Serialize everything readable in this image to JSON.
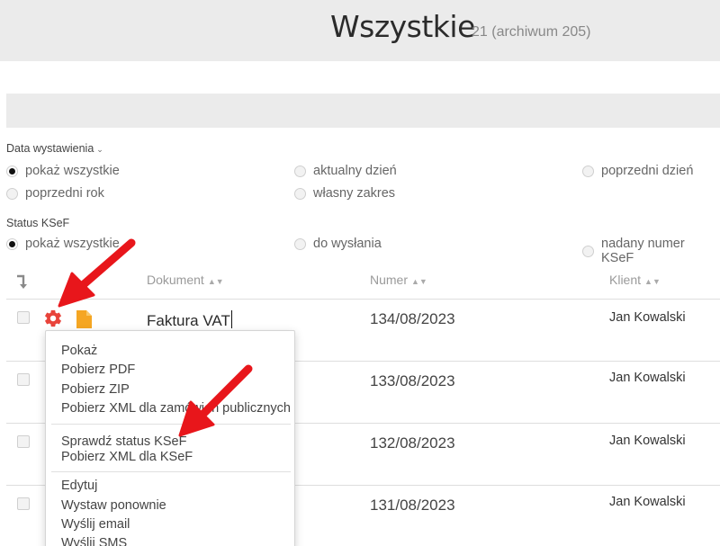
{
  "header": {
    "title": "Wszystkie",
    "count": "21 (archiwum 205)"
  },
  "filters": {
    "date": {
      "label": "Data wystawienia",
      "options": [
        {
          "label": "pokaż wszystkie",
          "checked": true
        },
        {
          "label": "aktualny dzień",
          "checked": false
        },
        {
          "label": "poprzedni dzień",
          "checked": false
        },
        {
          "label": "poprzedni rok",
          "checked": false
        },
        {
          "label": "własny zakres",
          "checked": false
        }
      ]
    },
    "ksef": {
      "label": "Status KSeF",
      "options": [
        {
          "label": "pokaż wszystkie",
          "checked": true
        },
        {
          "label": "do wysłania",
          "checked": false
        },
        {
          "label": "nadany numer KSeF",
          "checked": false
        }
      ]
    }
  },
  "table": {
    "columns": [
      "Dokument",
      "Numer",
      "Klient"
    ],
    "rows": [
      {
        "document": "Faktura VAT",
        "number": "134/08/2023",
        "client": "Jan Kowalski"
      },
      {
        "document": "",
        "number": "133/08/2023",
        "client": "Jan Kowalski"
      },
      {
        "document": "",
        "number": "132/08/2023",
        "client": "Jan Kowalski"
      },
      {
        "document": "",
        "number": "131/08/2023",
        "client": "Jan Kowalski"
      }
    ]
  },
  "context_menu": {
    "items": [
      "Pokaż",
      "Pobierz PDF",
      "Pobierz ZIP",
      "Pobierz XML dla zamówień publicznych",
      "Sprawdź status KSeF",
      "Pobierz XML dla KSeF",
      "Edytuj",
      "Wystaw ponownie",
      "Wyślij email",
      "Wyślij SMS"
    ]
  },
  "colors": {
    "header_bg": "#ebebeb",
    "gear": "#e8433a",
    "document_icon": "#f5a623",
    "annotation_arrow": "#e8161b"
  },
  "icons": [
    "sort-down-icon",
    "gear-icon",
    "document-icon",
    "chevron-down-icon",
    "sort-icon"
  ]
}
